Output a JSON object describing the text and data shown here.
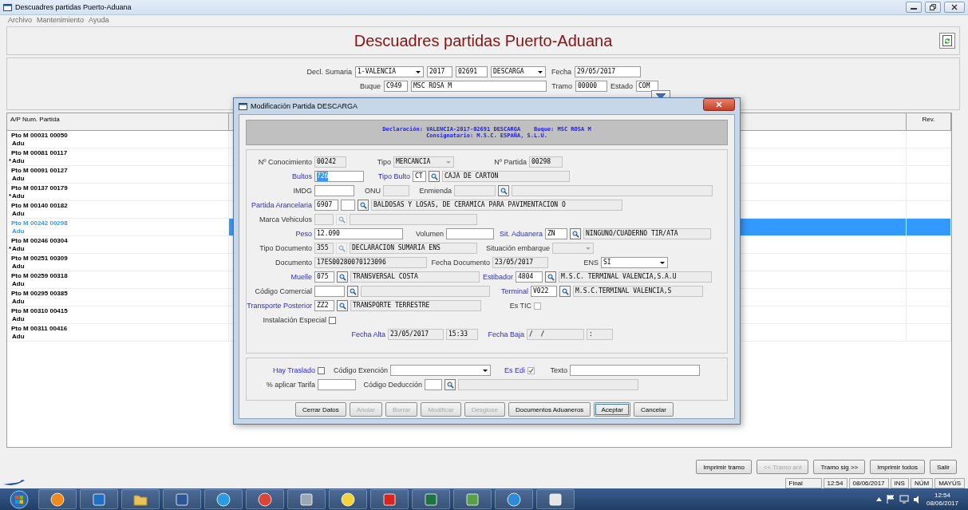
{
  "window": {
    "title": "Descuadres partidas Puerto-Aduana"
  },
  "menu": [
    {
      "label": "Archivo"
    },
    {
      "label": "Mantenimiento"
    },
    {
      "label": "Ayuda"
    }
  ],
  "header": {
    "title": "Descuadres partidas Puerto-Aduana"
  },
  "filters": {
    "lines": [
      {
        "fields": [
          {
            "label": "Decl. Sumaria",
            "controls": [
              {
                "kind": "combo",
                "value": "1-VALENCIA",
                "disabled": false
              },
              {
                "kind": "input",
                "value": "2017",
                "disabled": false
              },
              {
                "kind": "input",
                "value": "02691",
                "disabled": false
              },
              {
                "kind": "combo",
                "value": "DESCARGA",
                "disabled": false
              }
            ]
          },
          {
            "label": "Fecha",
            "controls": [
              {
                "kind": "input",
                "value": "29/05/2017",
                "disabled": false
              }
            ]
          }
        ]
      },
      {
        "fields": [
          {
            "label": "Buque",
            "controls": [
              {
                "kind": "input",
                "value": "C949",
                "disabled": false
              },
              {
                "kind": "input",
                "value": "MSC ROSA M",
                "disabled": false
              }
            ]
          },
          {
            "label": "Tramo",
            "controls": [
              {
                "kind": "input",
                "value": "00000",
                "disabled": false
              }
            ]
          },
          {
            "label": "Estado",
            "controls": [
              {
                "kind": "input",
                "value": "COM",
                "disabled": false
              }
            ]
          }
        ]
      },
      {
        "fields": [
          {
            "controls": [
              {
                "kind": "filter"
              }
            ]
          }
        ]
      }
    ]
  },
  "table": {
    "columns": [
      "A/P Num. Partida",
      "Rev."
    ],
    "rows": [
      {
        "partida": "Pto M 00031 00050",
        "origin": "Adu",
        "selected": false
      },
      {
        "partida": "Pto M 00081 00117",
        "mark": "*",
        "origin": "Adu",
        "selected": false
      },
      {
        "partida": "Pto M 00091 00127",
        "origin": "Adu",
        "selected": false
      },
      {
        "partida": "Pto M 00137 00179",
        "mark": "*",
        "origin": "Adu",
        "selected": false
      },
      {
        "partida": "Pto M 00140 00182",
        "origin": "Adu",
        "selected": false
      },
      {
        "partida": "Pto M 00242 00298",
        "origin": "Adu",
        "selected": true
      },
      {
        "partida": "Pto M 00246 00304",
        "mark": "*",
        "origin": "Adu",
        "selected": false
      },
      {
        "partida": "Pto M 00251 00309",
        "origin": "Adu",
        "selected": false
      },
      {
        "partida": "Pto M 00259 00318",
        "origin": "Adu",
        "selected": false
      },
      {
        "partida": "Pto M 00295 00385",
        "origin": "Adu",
        "selected": false
      },
      {
        "partida": "Pto M 00310 00415",
        "origin": "Adu",
        "selected": false
      },
      {
        "partida": "Pto M 00311 00416",
        "origin": "Adu",
        "selected": false
      }
    ]
  },
  "actions": [
    {
      "label": "Imprimir tramo",
      "disabled": false
    },
    {
      "label": "<< Tramo ant",
      "disabled": true
    },
    {
      "label": "Tramo sig >>",
      "disabled": false
    },
    {
      "label": "Imprimir todos",
      "disabled": false
    },
    {
      "label": "Salir",
      "disabled": false
    }
  ],
  "status_bar": [
    "Final",
    "12:54",
    "08/06/2017",
    "INS",
    "NÚM",
    "MAYÚS"
  ],
  "taskbar": {
    "apps": [
      {
        "kind": "media"
      },
      {
        "kind": "mail"
      },
      {
        "kind": "folder"
      },
      {
        "kind": "word"
      },
      {
        "kind": "ie"
      },
      {
        "kind": "chrome"
      },
      {
        "kind": "calculator"
      },
      {
        "kind": "flash"
      },
      {
        "kind": "pdf"
      },
      {
        "kind": "excel"
      },
      {
        "kind": "network"
      },
      {
        "kind": "globe"
      },
      {
        "kind": "card"
      }
    ],
    "time": "12:54",
    "date": "08/06/2017"
  },
  "dialog": {
    "title": "Modificación Partida DESCARGA",
    "banner": [
      "Declaración: VALENCIA-2017-02691 DESCARGA    Buque: MSC ROSA M",
      "Consignatario: M.S.C. ESPAÑA, S.L.U."
    ],
    "sections": [
      [
        [
          {
            "kind": "label",
            "text": "Nº Conocimiento",
            "link": false
          },
          {
            "kind": "input",
            "value": "00242",
            "disabled": true
          },
          {
            "kind": "label",
            "text": "Tipo",
            "link": false
          },
          {
            "kind": "combo",
            "value": "MERCANCIA",
            "disabled": true
          },
          {
            "kind": "label",
            "text": "Nº Partida",
            "link": false
          },
          {
            "kind": "input",
            "value": "00298",
            "disabled": true
          }
        ],
        [
          {
            "kind": "label",
            "text": "Bultos",
            "link": true
          },
          {
            "kind": "input",
            "value": "726",
            "disabled": false,
            "highlighted": true
          },
          {
            "kind": "label",
            "text": "Tipo Bulto",
            "link": true
          },
          {
            "kind": "input",
            "value": "CT",
            "disabled": false
          },
          {
            "kind": "lookup",
            "disabled": false
          },
          {
            "kind": "input",
            "value": "CAJA DE CARTON",
            "disabled": true
          }
        ],
        [
          {
            "kind": "label",
            "text": "IMDG",
            "link": false
          },
          {
            "kind": "input",
            "disabled": false
          },
          {
            "kind": "label",
            "text": "ONU",
            "link": false
          },
          {
            "kind": "input",
            "disabled": true
          },
          {
            "kind": "label",
            "text": "Enmienda",
            "link": false
          },
          {
            "kind": "input",
            "disabled": true
          },
          {
            "kind": "lookup",
            "disabled": false
          },
          {
            "kind": "input",
            "disabled": true
          }
        ],
        [
          {
            "kind": "label",
            "text": "Partida Arancelaria",
            "link": true
          },
          {
            "kind": "input",
            "value": "6907",
            "disabled": false
          },
          {
            "kind": "input",
            "disabled": false
          },
          {
            "kind": "lookup",
            "disabled": false
          },
          {
            "kind": "input",
            "value": "BALDOSAS Y LOSAS, DE CERAMICA PARA PAVIMENTACION O",
            "disabled": true
          }
        ],
        [
          {
            "kind": "label",
            "text": "Marca Vehiculos",
            "link": false
          },
          {
            "kind": "input",
            "disabled": true
          },
          {
            "kind": "lookup",
            "disabled": true
          },
          {
            "kind": "input",
            "disabled": true
          }
        ],
        [
          {
            "kind": "label",
            "text": "Peso",
            "link": true
          },
          {
            "kind": "input",
            "value": "12.090",
            "disabled": false
          },
          {
            "kind": "label",
            "text": "Volumen",
            "link": false
          },
          {
            "kind": "input",
            "disabled": false
          },
          {
            "kind": "label",
            "text": "Sit. Aduanera",
            "link": true
          },
          {
            "kind": "input",
            "value": "ZN",
            "disabled": false
          },
          {
            "kind": "lookup",
            "disabled": false
          },
          {
            "kind": "input",
            "value": "NINGUNO/CUADERNO TIR/ATA",
            "disabled": true
          }
        ],
        [
          {
            "kind": "label",
            "text": "Tipo Documento",
            "link": false
          },
          {
            "kind": "input",
            "value": "355",
            "disabled": true
          },
          {
            "kind": "lookup",
            "disabled": true
          },
          {
            "kind": "input",
            "value": "DECLARACION SUMARIA ENS",
            "disabled": true
          },
          {
            "kind": "label",
            "text": "Situación embarque",
            "link": false
          },
          {
            "kind": "combo",
            "disabled": true
          }
        ],
        [
          {
            "kind": "label",
            "text": "Documento",
            "link": false
          },
          {
            "kind": "input",
            "value": "17ES00280070123096",
            "disabled": true
          },
          {
            "kind": "label",
            "text": "Fecha Documento",
            "link": false
          },
          {
            "kind": "input",
            "value": "23/05/2017",
            "disabled": true
          },
          {
            "kind": "label",
            "text": "ENS",
            "link": false
          },
          {
            "kind": "combo",
            "value": "SI",
            "disabled": false
          }
        ],
        [
          {
            "kind": "label",
            "text": "Muelle",
            "link": true
          },
          {
            "kind": "input",
            "value": "075",
            "disabled": false
          },
          {
            "kind": "lookup",
            "disabled": false
          },
          {
            "kind": "input",
            "value": "TRANSVERSAL COSTA",
            "disabled": true
          },
          {
            "kind": "label",
            "text": "Estibador",
            "link": true
          },
          {
            "kind": "input",
            "value": "4804",
            "disabled": false
          },
          {
            "kind": "lookup",
            "disabled": false
          },
          {
            "kind": "input",
            "value": "M.S.C. TERMINAL VALENCIA,S.A.U",
            "disabled": true
          }
        ],
        [
          {
            "kind": "label",
            "text": "Código Comercial",
            "link": false
          },
          {
            "kind": "input",
            "disabled": false
          },
          {
            "kind": "lookup",
            "disabled": false
          },
          {
            "kind": "input",
            "disabled": true
          },
          {
            "kind": "label",
            "text": "Terminal",
            "link": true
          },
          {
            "kind": "input",
            "value": "V022",
            "disabled": false
          },
          {
            "kind": "lookup",
            "disabled": false
          },
          {
            "kind": "input",
            "value": "M.S.C.TERMINAL VALENCIA,S",
            "disabled": true
          }
        ],
        [
          {
            "kind": "label",
            "text": "Transporte Posterior",
            "link": true
          },
          {
            "kind": "input",
            "value": "ZZ2",
            "disabled": false
          },
          {
            "kind": "lookup",
            "disabled": false
          },
          {
            "kind": "input",
            "value": "TRANSPORTE TERRESTRE",
            "disabled": true
          },
          {
            "kind": "check",
            "label": "Es TIC",
            "link": false,
            "checked": false,
            "disabled": true
          }
        ],
        [
          {
            "kind": "check",
            "label": "Instalación Especial",
            "link": false,
            "checked": false,
            "disabled": false
          }
        ],
        [
          {
            "kind": "label",
            "text": "Fecha Alta",
            "link": true
          },
          {
            "kind": "input",
            "value": "23/05/2017",
            "disabled": true
          },
          {
            "kind": "input",
            "value": "15:33",
            "disabled": true
          },
          {
            "kind": "label",
            "text": "Fecha Baja",
            "link": true
          },
          {
            "kind": "input",
            "value": "/  /",
            "disabled": true
          },
          {
            "kind": "input",
            "value": ":",
            "disabled": true
          }
        ]
      ],
      [
        [
          {
            "kind": "check",
            "label": "Hay Traslado",
            "link": true,
            "checked": false,
            "disabled": false
          },
          {
            "kind": "label",
            "text": "Código Exención",
            "link": false
          },
          {
            "kind": "combo",
            "disabled": false
          },
          {
            "kind": "check",
            "label": "Es Edi",
            "link": true,
            "checked": true,
            "disabled": true
          },
          {
            "kind": "label",
            "text": "Texto",
            "link": false
          },
          {
            "kind": "input",
            "disabled": false
          }
        ],
        [
          {
            "kind": "label",
            "text": "% aplicar Tarifa",
            "link": false
          },
          {
            "kind": "input",
            "disabled": false
          },
          {
            "kind": "label",
            "text": "Código Deducción",
            "link": false
          },
          {
            "kind": "input",
            "disabled": false
          },
          {
            "kind": "lookup",
            "disabled": false
          },
          {
            "kind": "input",
            "disabled": true
          }
        ]
      ]
    ],
    "buttons": [
      {
        "label": "Cerrar Datos",
        "disabled": false,
        "default": false
      },
      {
        "label": "Anular",
        "disabled": true,
        "default": false
      },
      {
        "label": "Borrar",
        "disabled": true,
        "default": false
      },
      {
        "label": "Modificar",
        "disabled": true,
        "default": false
      },
      {
        "label": "Desglose",
        "disabled": true,
        "default": false
      },
      {
        "label": "Documentos Aduaneros",
        "disabled": false,
        "default": false
      },
      {
        "label": "Aceptar",
        "disabled": false,
        "default": true
      },
      {
        "label": "Cancelar",
        "disabled": false,
        "default": false
      }
    ]
  }
}
